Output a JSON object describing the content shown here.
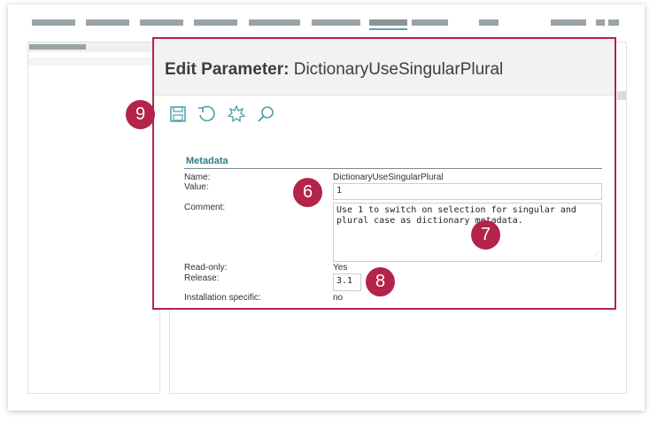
{
  "dialog": {
    "title_prefix": "Edit Parameter:",
    "title_name": "DictionaryUseSingularPlural"
  },
  "toolbar": {
    "buttons": [
      {
        "name": "save",
        "icon": "save-icon"
      },
      {
        "name": "undo",
        "icon": "undo-icon"
      },
      {
        "name": "new",
        "icon": "star-burst-icon"
      },
      {
        "name": "search",
        "icon": "search-icon"
      }
    ]
  },
  "metadata": {
    "section_title": "Metadata",
    "name_label": "Name:",
    "name_value": "DictionaryUseSingularPlural",
    "value_label": "Value:",
    "value_field": "1",
    "comment_label": "Comment:",
    "comment_field": "Use 1 to switch on selection for singular and plural case as dictionary metadata.",
    "readonly_label": "Read-only:",
    "readonly_value": "Yes",
    "release_label": "Release:",
    "release_field": "3.1",
    "installation_label": "Installation specific:",
    "installation_value": "no"
  },
  "callouts": {
    "c6": "6",
    "c7": "7",
    "c8": "8",
    "c9": "9"
  },
  "colors": {
    "accent": "#b3234a",
    "section_title": "#2a7f8a",
    "icon": "#4a9ea8"
  }
}
